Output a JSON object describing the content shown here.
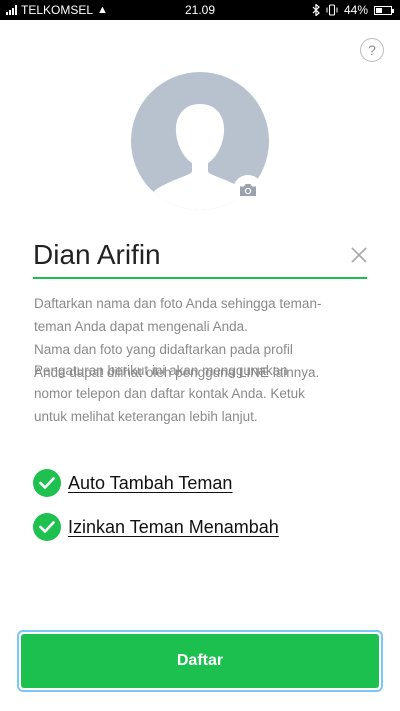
{
  "status_bar": {
    "carrier": "TELKOMSEL",
    "time": "21.09",
    "battery": "44%",
    "battery_level": 0.44,
    "icons": [
      "signal-icon",
      "warning-icon",
      "bluetooth-icon",
      "vibrate-icon",
      "battery-icon"
    ]
  },
  "header": {
    "help_label": "?"
  },
  "profile": {
    "avatar_icon": "default-avatar-icon",
    "camera_icon": "camera-icon",
    "avatar_bg": "#b7c2ce"
  },
  "name_field": {
    "value": "Dian Arifin",
    "clear_icon": "close-icon",
    "accent": "#1ebf52"
  },
  "info": {
    "paragraph1_line1": "Daftarkan nama dan foto Anda sehingga teman-",
    "paragraph1_line2": "teman Anda dapat mengenali Anda.",
    "paragraph1_line3": "Nama dan foto yang didaftarkan pada profil",
    "paragraph1_line4": "Anda dapat dilihat oleh pengguna LINE lainnya.",
    "paragraph2_line1": "Pengaturan berikut ini akan menggunakan",
    "paragraph2_line2": "nomor telepon dan daftar kontak Anda. Ketuk",
    "paragraph2_line3": "untuk melihat keterangan lebih lanjut."
  },
  "options": [
    {
      "label": "Auto Tambah Teman",
      "checked": true
    },
    {
      "label": "Izinkan Teman Menambah",
      "checked": true
    }
  ],
  "submit": {
    "label": "Daftar",
    "color": "#1cc04f"
  }
}
